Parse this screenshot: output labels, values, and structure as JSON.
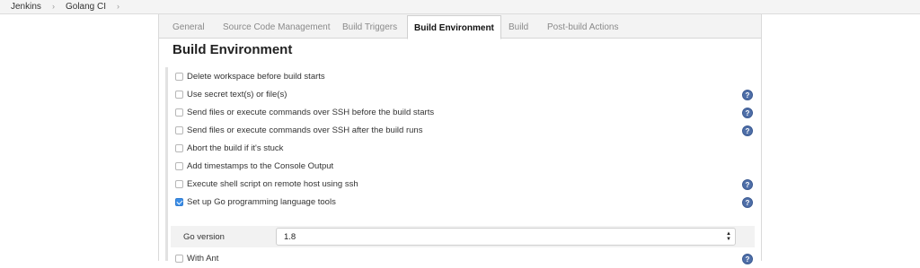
{
  "breadcrumbs": [
    {
      "label": "Jenkins"
    },
    {
      "label": "Golang CI"
    }
  ],
  "tabs": [
    {
      "label": "General"
    },
    {
      "label": "Source Code Management"
    },
    {
      "label": "Build Triggers"
    },
    {
      "label": "Build Environment",
      "active": true
    },
    {
      "label": "Build"
    },
    {
      "label": "Post-build Actions"
    }
  ],
  "section": {
    "title": "Build Environment",
    "options": [
      {
        "label": "Delete workspace before build starts",
        "checked": false,
        "help": false
      },
      {
        "label": "Use secret text(s) or file(s)",
        "checked": false,
        "help": true
      },
      {
        "label": "Send files or execute commands over SSH before the build starts",
        "checked": false,
        "help": true
      },
      {
        "label": "Send files or execute commands over SSH after the build runs",
        "checked": false,
        "help": true
      },
      {
        "label": "Abort the build if it's stuck",
        "checked": false,
        "help": false
      },
      {
        "label": "Add timestamps to the Console Output",
        "checked": false,
        "help": false
      },
      {
        "label": "Execute shell script on remote host using ssh",
        "checked": false,
        "help": true
      },
      {
        "label": "Set up Go programming language tools",
        "checked": true,
        "help": true
      },
      {
        "label": "With Ant",
        "checked": false,
        "help": true
      }
    ],
    "go_version": {
      "label": "Go version",
      "value": "1.8"
    }
  },
  "icons": {
    "help": "?",
    "breadcrumb_separator": "›",
    "select_arrows": "▲▼"
  },
  "colors": {
    "checkbox_checked": "#3b8ee7",
    "help_icon": "#4f6fa8",
    "tab_bar": "#f3f3f3"
  }
}
